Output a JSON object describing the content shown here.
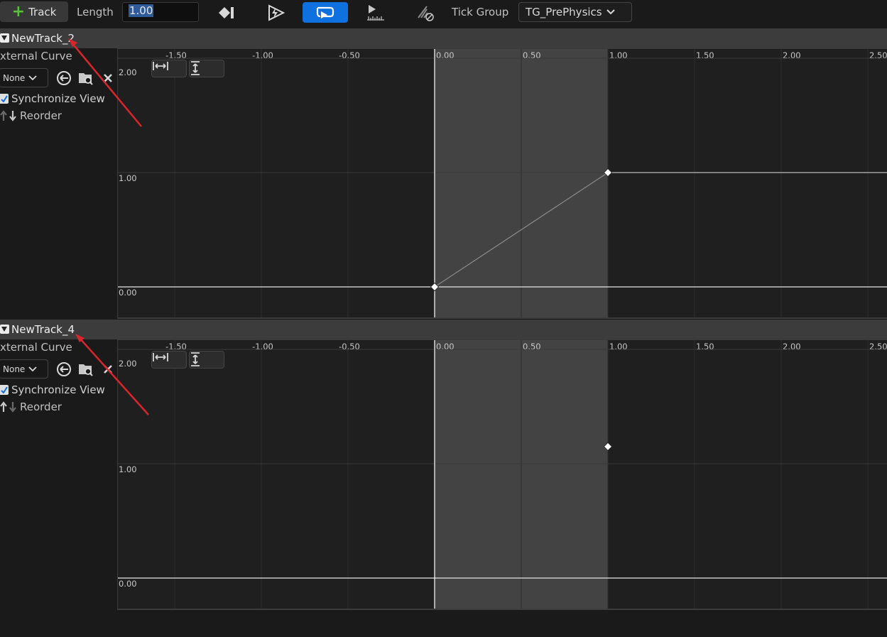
{
  "toolbar": {
    "add_track_label": "Track",
    "length_label": "Length",
    "length_value": "1.00",
    "tick_group_label": "Tick Group",
    "tick_group_value": "TG_PrePhysics",
    "icons": [
      "add-key-icon",
      "autoplay-icon",
      "loop-icon",
      "use-last-keyframe-icon",
      "replicated-icon"
    ]
  },
  "tracks": [
    {
      "name": "NewTrack_2",
      "external_curve_label": "xternal Curve",
      "curve_value": "None",
      "sync_label": "Synchronize View",
      "reorder_label": "Reorder",
      "x_ticks": [
        "-1.50",
        "-1.00",
        "-0.50",
        "0.00",
        "0.50",
        "1.00",
        "1.50",
        "2.00",
        "2.50"
      ],
      "y_ticks": [
        "2.00",
        "1.00",
        "0.00"
      ],
      "keys": [
        {
          "time": 0.0,
          "value": 0.0
        },
        {
          "time": 1.0,
          "value": 1.0
        }
      ],
      "range": [
        0.0,
        1.0
      ]
    },
    {
      "name": "NewTrack_4",
      "external_curve_label": "xternal Curve",
      "curve_value": "None",
      "sync_label": "Synchronize View",
      "reorder_label": "Reorder",
      "x_ticks": [
        "-1.50",
        "-1.00",
        "-0.50",
        "0.00",
        "0.50",
        "1.00",
        "1.50",
        "2.00",
        "2.50"
      ],
      "y_ticks": [
        "2.00",
        "1.00",
        "0.00"
      ],
      "keys": [
        {
          "time": 1.0,
          "value": 1.15
        }
      ],
      "range": [
        0.0,
        1.0
      ]
    }
  ],
  "colors": {
    "accent": "#0f70e0",
    "annotation_arrow": "#d9262c",
    "range_fill": "#4a4a4a",
    "curve": "#8a8a8a"
  }
}
